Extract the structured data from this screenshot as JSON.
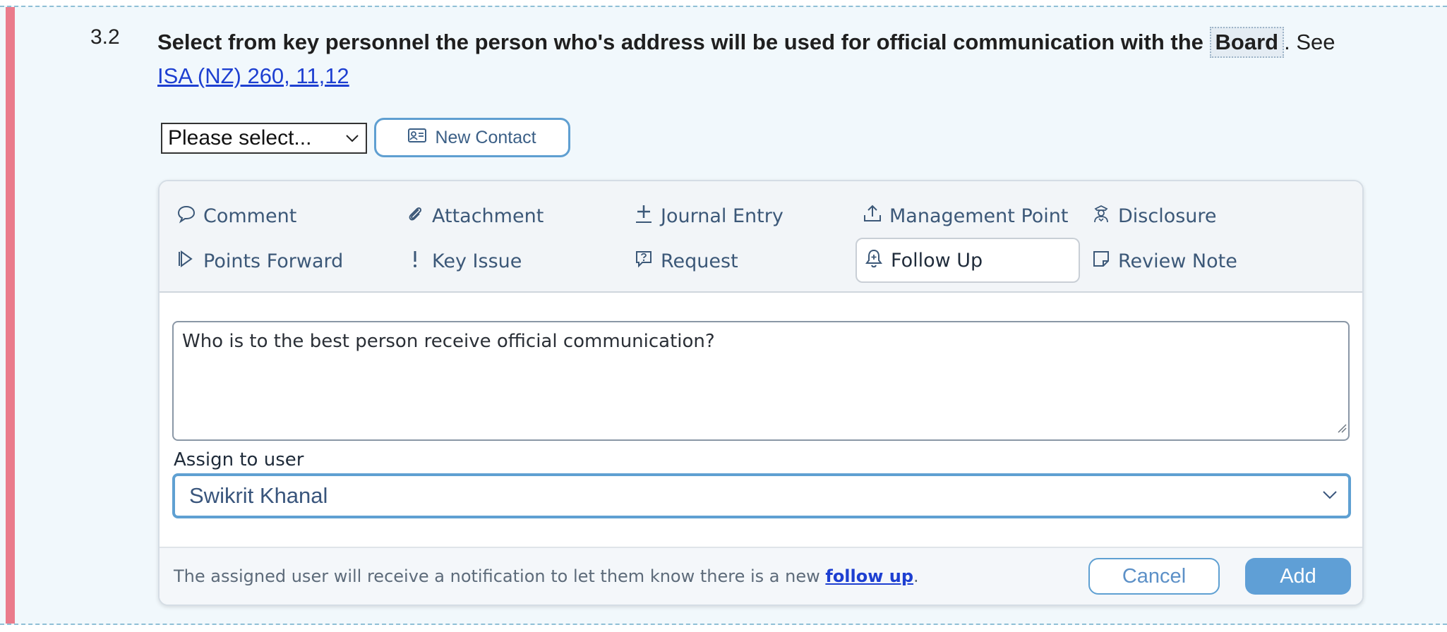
{
  "question": {
    "number": "3.2",
    "text": "Select from key personnel the person who's address will be used for official communication with the",
    "term": "Board",
    "after_term": ". See",
    "link": "ISA (NZ) 260, 11,12"
  },
  "contact_select": {
    "value": "Please select..."
  },
  "new_contact_button": {
    "label": "New Contact"
  },
  "tabs": [
    {
      "label": "Comment",
      "icon": "comment-icon"
    },
    {
      "label": "Attachment",
      "icon": "paperclip-icon"
    },
    {
      "label": "Journal Entry",
      "icon": "plus-icon"
    },
    {
      "label": "Management Point",
      "icon": "upload-icon"
    },
    {
      "label": "Disclosure",
      "icon": "officer-icon"
    },
    {
      "label": "Points Forward",
      "icon": "forward-icon"
    },
    {
      "label": "Key Issue",
      "icon": "exclamation-icon"
    },
    {
      "label": "Request",
      "icon": "question-bubble-icon"
    },
    {
      "label": "Follow Up",
      "icon": "bell-icon",
      "active": true
    },
    {
      "label": "Review Note",
      "icon": "note-icon"
    }
  ],
  "comment": {
    "value": "Who is to the best person receive official communication?"
  },
  "assign": {
    "label": "Assign to user",
    "value": "Swikrit Khanal"
  },
  "footer": {
    "note_prefix": "The assigned user will receive a notification to let them know there is a new",
    "note_link": "follow up",
    "note_suffix": ".",
    "cancel_label": "Cancel",
    "add_label": "Add"
  },
  "colors": {
    "accent": "#5f9fd6",
    "left_bar": "#ea7b8b",
    "link": "#1d3fd1"
  }
}
